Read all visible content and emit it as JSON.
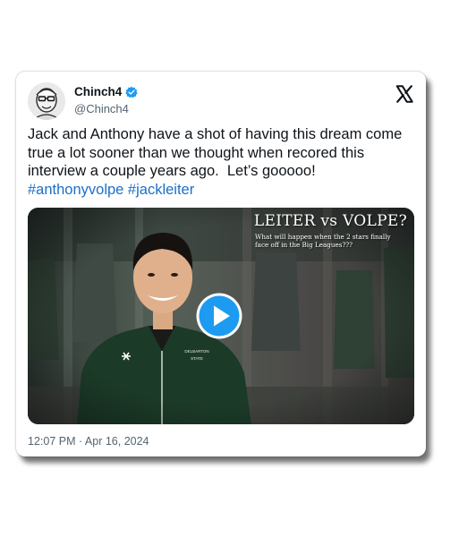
{
  "tweet": {
    "display_name": "Chinch4",
    "handle": "@Chinch4",
    "text": "Jack and Anthony have a shot of having this dream come true a lot sooner than we thought when recored this interview a couple years ago.  Let’s gooooo!",
    "hashtags": "#anthonyvolpe #jackleiter",
    "timestamp": "12:07 PM · Apr 16, 2024"
  },
  "video": {
    "title": "LEITER vs VOLPE?",
    "subtitle": "What will happen when the 2 stars finally face off in the Big Leagues???"
  },
  "colors": {
    "verified_badge": "#1d9bf0",
    "hashtag": "#1d6fc8",
    "play_button": "#1d9bf0"
  },
  "icons": {
    "verified": "verified-badge-icon",
    "platform": "x-logo-icon",
    "play": "play-icon"
  }
}
